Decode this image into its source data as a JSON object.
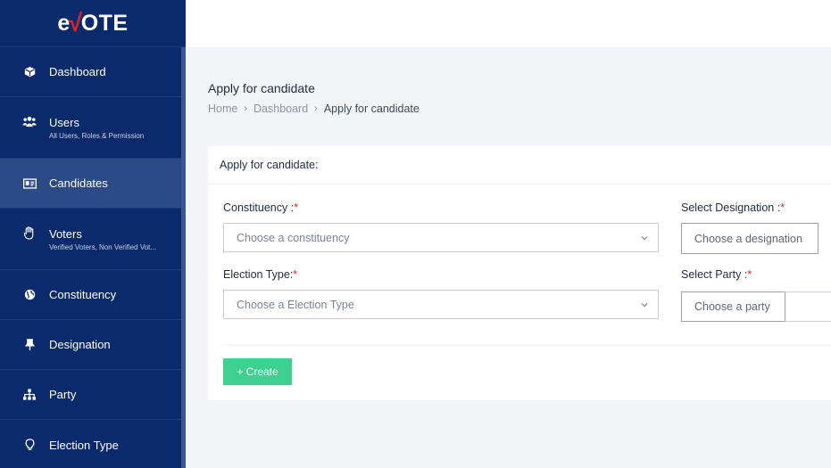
{
  "logo": {
    "prefix": "e",
    "check": "√",
    "suffix": "OTE"
  },
  "sidebar": {
    "items": [
      {
        "label": "Dashboard",
        "sub": "",
        "icon": "cube-icon"
      },
      {
        "label": "Users",
        "sub": "All Users, Roles & Permission",
        "icon": "users-icon"
      },
      {
        "label": "Candidates",
        "sub": "",
        "icon": "id-card-icon"
      },
      {
        "label": "Voters",
        "sub": "Verified Voters, Non Verified Vot...",
        "icon": "hand-icon"
      },
      {
        "label": "Constituency",
        "sub": "",
        "icon": "globe-icon"
      },
      {
        "label": "Designation",
        "sub": "",
        "icon": "pin-icon"
      },
      {
        "label": "Party",
        "sub": "",
        "icon": "sitemap-icon"
      },
      {
        "label": "Election Type",
        "sub": "",
        "icon": "bulb-icon"
      }
    ]
  },
  "page": {
    "title": "Apply for candidate",
    "breadcrumb": [
      "Home",
      "Dashboard",
      "Apply for candidate"
    ]
  },
  "card": {
    "header": "Apply for candidate:",
    "constituency": {
      "label": "Constituency :",
      "required": "*",
      "placeholder": "Choose a constituency"
    },
    "election_type": {
      "label": "Election Type:",
      "required": "*",
      "placeholder": "Choose a Election Type"
    },
    "designation": {
      "label": "Select Designation :",
      "required": "*",
      "placeholder": "Choose a designation"
    },
    "party": {
      "label": "Select Party :",
      "required": "*",
      "placeholder": "Choose a party"
    },
    "create_button": "+ Create"
  },
  "colors": {
    "sidebar": "#0b2a6b",
    "sidebar_active": "#2c4a86",
    "accent_green": "#3ed08e",
    "required_red": "#e02424"
  }
}
